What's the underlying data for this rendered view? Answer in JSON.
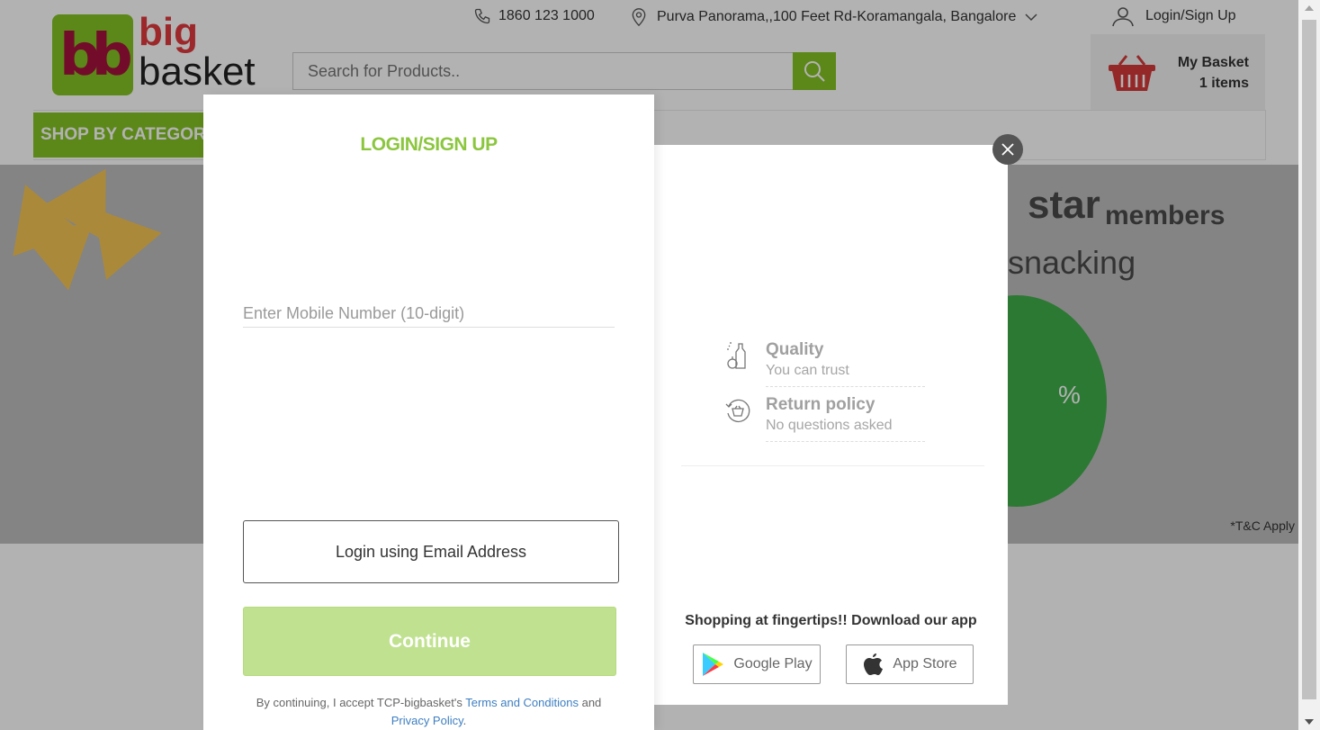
{
  "header": {
    "phone": "1860 123 1000",
    "location": "Purva Panorama,,100 Feet Rd-Koramangala, Bangalore",
    "login": "Login/Sign Up",
    "logo_big": "big",
    "logo_basket": "basket",
    "logo_bb": "bb",
    "search_placeholder": "Search for Products..",
    "basket_title": "My Basket",
    "basket_count": "1 items",
    "shop_by_category": "SHOP BY CATEGORY"
  },
  "banner": {
    "star": "star",
    "members": "members",
    "snacking": "snacking",
    "percent": "%",
    "tc": "*T&C Apply"
  },
  "modal": {
    "title": "LOGIN/SIGN UP",
    "mobile_placeholder": "Enter Mobile Number (10-digit)",
    "email_button": "Login using Email Address",
    "continue_button": "Continue",
    "terms_prefix": "By continuing, I accept TCP-bigbasket's",
    "terms_link": "Terms and Conditions",
    "terms_and": "and",
    "privacy_link": "Privacy Policy",
    "terms_suffix": ".",
    "features": [
      {
        "title": "Quality",
        "subtitle": "You can trust",
        "icon": "quality-icon"
      },
      {
        "title": "Return policy",
        "subtitle": "No questions asked",
        "icon": "return-policy-icon"
      }
    ],
    "app_text": "Shopping at fingertips!! Download our app",
    "google_play": "Google Play",
    "app_store": "App Store"
  },
  "colors": {
    "brand_green": "#84c225",
    "continue_disabled": "#c0e18f",
    "link_blue": "#3e7fc1"
  }
}
